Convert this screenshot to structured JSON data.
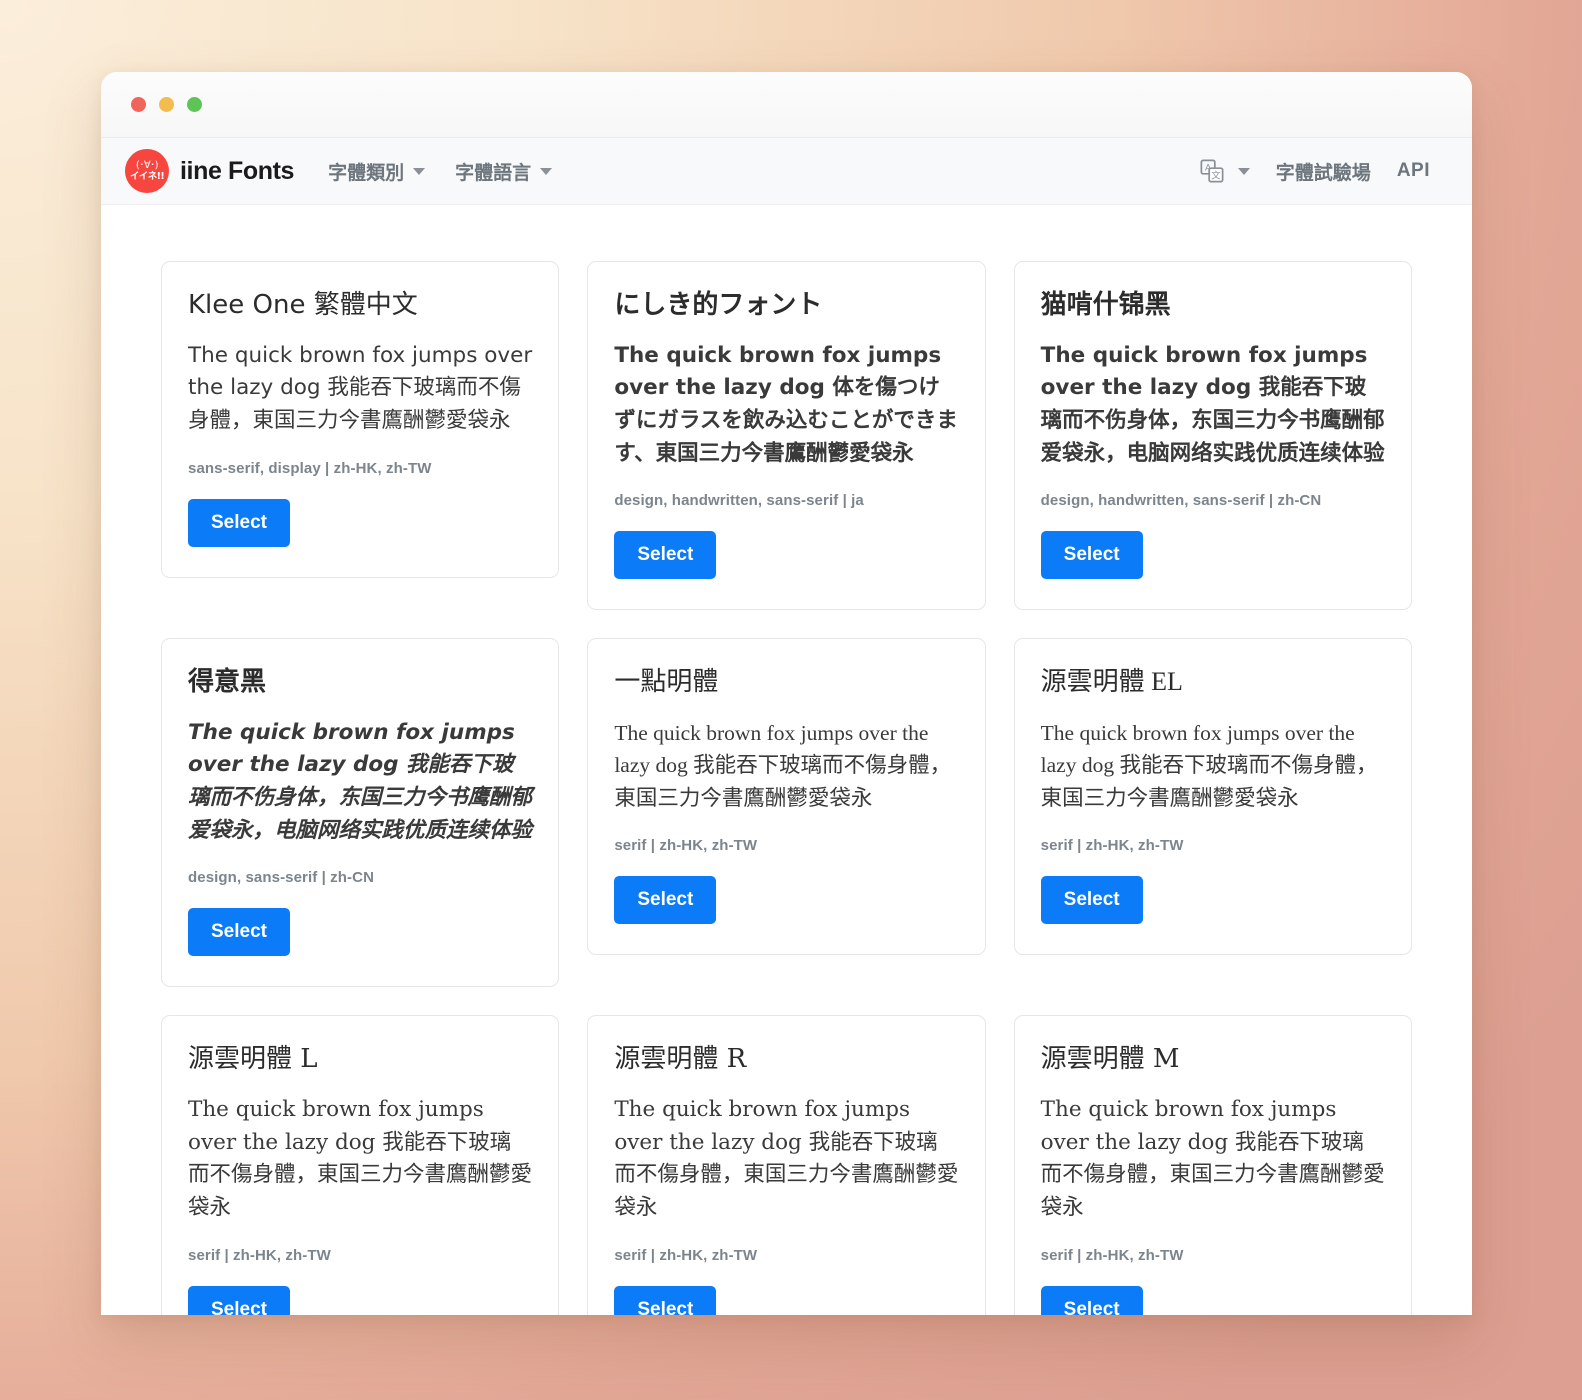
{
  "window": {
    "traffic_lights": [
      {
        "name": "close",
        "color": "#f0645c"
      },
      {
        "name": "minimize",
        "color": "#f3bc4f"
      },
      {
        "name": "maximize",
        "color": "#5fc457"
      }
    ]
  },
  "navbar": {
    "logo": {
      "kaomoji": "(･∀･)",
      "sub": "イイネ!!",
      "color": "#f7463f"
    },
    "brand_name": "iine Fonts",
    "menus": [
      {
        "label": "字體類別",
        "icon": "chevron-down-icon"
      },
      {
        "label": "字體語言",
        "icon": "chevron-down-icon"
      }
    ],
    "language_switcher": {
      "icon": "translate-icon",
      "caret": "chevron-down-icon"
    },
    "links": [
      {
        "label": "字體試驗場"
      },
      {
        "label": "API"
      }
    ]
  },
  "theme": {
    "accent": "#0b7bf7",
    "card_border": "#e6e6e6",
    "navbar_bg": "#f8f9fa",
    "muted_text": "#7c858d"
  },
  "cards": [
    {
      "title": "Klee One 繁體中文",
      "sample": "The quick brown fox jumps over the lazy dog 我能吞下玻璃而不傷身體，東国三力今書鷹酬鬱愛袋永",
      "meta": "sans-serif, display | zh-HK, zh-TW",
      "button": "Select",
      "style": "style-rounded"
    },
    {
      "title": "にしき的フォント",
      "sample": "The quick brown fox jumps over the lazy dog 体を傷つけずにガラスを飲み込むことができます、東国三力今書鷹酬鬱愛袋永",
      "meta": "design, handwritten, sans-serif | ja",
      "button": "Select",
      "style": "style-bold"
    },
    {
      "title": "猫啃什锦黑",
      "sample": "The quick brown fox jumps over the lazy dog 我能吞下玻璃而不伤身体，东国三力今书鹰酬郁爱袋永，电脑网络实践优质连续体验",
      "meta": "design, handwritten, sans-serif | zh-CN",
      "button": "Select",
      "style": "style-bold"
    },
    {
      "title": "得意黑",
      "sample": "The quick brown fox jumps over the lazy dog 我能吞下玻璃而不伤身体，东国三力今书鹰酬郁爱袋永，电脑网络实践优质连续体验",
      "meta": "design, sans-serif | zh-CN",
      "button": "Select",
      "style": "style-italic"
    },
    {
      "title": "一點明體",
      "sample": "The quick brown fox jumps over the lazy dog 我能吞下玻璃而不傷身體，東国三力今書鷹酬鬱愛袋永",
      "meta": "serif | zh-HK, zh-TW",
      "button": "Select",
      "style": "style-serif-light"
    },
    {
      "title": "源雲明體 EL",
      "sample": "The quick brown fox jumps over the lazy dog 我能吞下玻璃而不傷身體，東国三力今書鷹酬鬱愛袋永",
      "meta": "serif | zh-HK, zh-TW",
      "button": "Select",
      "style": "style-serif-light"
    },
    {
      "title": "源雲明體 L",
      "sample": "The quick brown fox jumps over the lazy dog 我能吞下玻璃而不傷身體，東国三力今書鷹酬鬱愛袋永",
      "meta": "serif | zh-HK, zh-TW",
      "button": "Select",
      "style": "style-serif"
    },
    {
      "title": "源雲明體 R",
      "sample": "The quick brown fox jumps over the lazy dog 我能吞下玻璃而不傷身體，東国三力今書鷹酬鬱愛袋永",
      "meta": "serif | zh-HK, zh-TW",
      "button": "Select",
      "style": "style-serif"
    },
    {
      "title": "源雲明體 M",
      "sample": "The quick brown fox jumps over the lazy dog 我能吞下玻璃而不傷身體，東国三力今書鷹酬鬱愛袋永",
      "meta": "serif | zh-HK, zh-TW",
      "button": "Select",
      "style": "style-serif"
    }
  ]
}
